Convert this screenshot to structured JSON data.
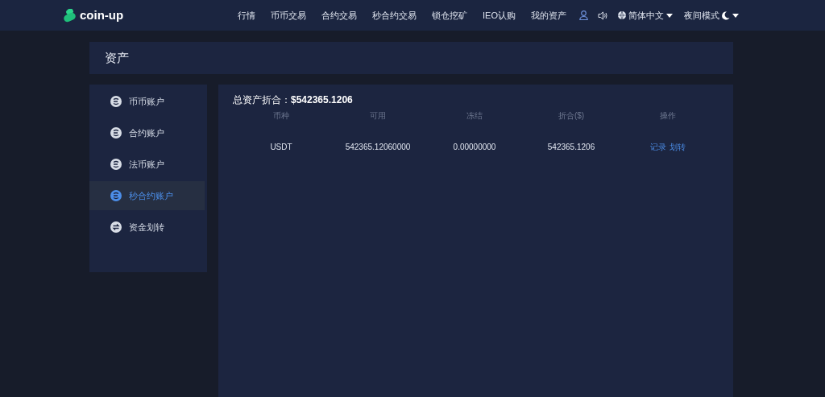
{
  "header": {
    "logo": "coin-up",
    "nav": [
      "行情",
      "币币交易",
      "合约交易",
      "秒合约交易",
      "锁仓挖矿",
      "IEO认购",
      "我的资产"
    ],
    "language": "简体中文",
    "theme": "夜间模式"
  },
  "page_title": "资产",
  "sidebar": {
    "items": [
      {
        "label": "币币账户",
        "kind": "account",
        "selected": false
      },
      {
        "label": "合约账户",
        "kind": "account",
        "selected": false
      },
      {
        "label": "法币账户",
        "kind": "account",
        "selected": false
      },
      {
        "label": "秒合约账户",
        "kind": "account",
        "selected": true
      },
      {
        "label": "资金划转",
        "kind": "transfer",
        "selected": false
      }
    ]
  },
  "total": {
    "label": "总资产折合：",
    "value": "$542365.1206"
  },
  "table": {
    "columns": [
      "币种",
      "可用",
      "冻结",
      "折合($)",
      "操作"
    ],
    "rows": [
      {
        "cells": [
          "USDT",
          "542365.12060000",
          "0.00000000",
          "542365.1206"
        ],
        "actions": [
          "记录",
          "划转"
        ]
      }
    ]
  }
}
